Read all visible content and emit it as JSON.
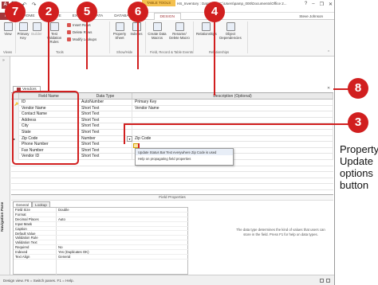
{
  "app": {
    "context_tab": "TABLE TOOLS",
    "window_title": "HS_Inventory : Database- C:\\Users\\pamp_000\\Documents\\Office 2...",
    "user": "Steve Johnson"
  },
  "ribbon_tabs": [
    "FILE",
    "HOME",
    "CREATE",
    "EXTERNAL DATA",
    "DATABASE TOOLS",
    "DESIGN"
  ],
  "ribbon": {
    "views": {
      "view_label": "View",
      "group": "Views"
    },
    "tools": {
      "primary_key": "Primary Key",
      "builder": "Builder",
      "test_validation": "Test Validation Rules",
      "insert_rows": "Insert Rows",
      "delete_rows": "Delete Rows",
      "modify_lookups": "Modify Lookups",
      "group": "Tools"
    },
    "showhide": {
      "property_sheet": "Property Sheet",
      "indexes": "Indexes",
      "group": "Show/Hide"
    },
    "events": {
      "create_macros": "Create Data Macros",
      "rename_delete": "Rename/ Delete Macro",
      "group": "Field, Record & Table Events"
    },
    "relationships": {
      "relationships": "Relationships",
      "object_dependencies": "Object Dependencies",
      "group": "Relationships"
    }
  },
  "nav_pane": {
    "label": "Navigation Pane"
  },
  "document_tab": "Vendors",
  "grid": {
    "headers": [
      "Field Name",
      "Data Type",
      "Description (Optional)"
    ],
    "rows": [
      {
        "field": "ID",
        "type": "AutoNumber",
        "desc": "Primary Key"
      },
      {
        "field": "Vendor Name",
        "type": "Short Text",
        "desc": "Vendor Name"
      },
      {
        "field": "Contact Name",
        "type": "Short Text",
        "desc": ""
      },
      {
        "field": "Address",
        "type": "Short Text",
        "desc": ""
      },
      {
        "field": "City",
        "type": "Short Text",
        "desc": ""
      },
      {
        "field": "State",
        "type": "Short Text",
        "desc": ""
      },
      {
        "field": "Zip Code",
        "type": "Number",
        "desc": "Zip Code"
      },
      {
        "field": "Phone Number",
        "type": "Short Text",
        "desc": ""
      },
      {
        "field": "Fax Number",
        "type": "Short Text",
        "desc": ""
      },
      {
        "field": "Vendor ID",
        "type": "Short Text",
        "desc": ""
      }
    ]
  },
  "popup": {
    "item1": "Update Status Bar Text everywhere Zip Code is used",
    "item2": "Help on propagating field properties"
  },
  "field_properties": {
    "title": "Field Properties",
    "tabs": [
      "General",
      "Lookup"
    ],
    "rows": [
      {
        "label": "Field Size",
        "value": "Double"
      },
      {
        "label": "Format",
        "value": ""
      },
      {
        "label": "Decimal Places",
        "value": "Auto"
      },
      {
        "label": "Input Mask",
        "value": ""
      },
      {
        "label": "Caption",
        "value": ""
      },
      {
        "label": "Default Value",
        "value": ""
      },
      {
        "label": "Validation Rule",
        "value": ""
      },
      {
        "label": "Validation Text",
        "value": ""
      },
      {
        "label": "Required",
        "value": "No"
      },
      {
        "label": "Indexed",
        "value": "Yes (Duplicates OK)"
      },
      {
        "label": "Text Align",
        "value": "General"
      }
    ],
    "help": "The data type determines the kind of values that users can store in the field. Press F1 for help on data types."
  },
  "status_bar": "Design view.  F6 = Switch panes.  F1 = Help.",
  "callouts": [
    "7",
    "2",
    "5",
    "6",
    "4",
    "8",
    "3"
  ],
  "annotation": "Property Update options button",
  "colors": {
    "accent": "#a4373a",
    "callout": "#d11f1f",
    "context": "#f3c04f"
  }
}
